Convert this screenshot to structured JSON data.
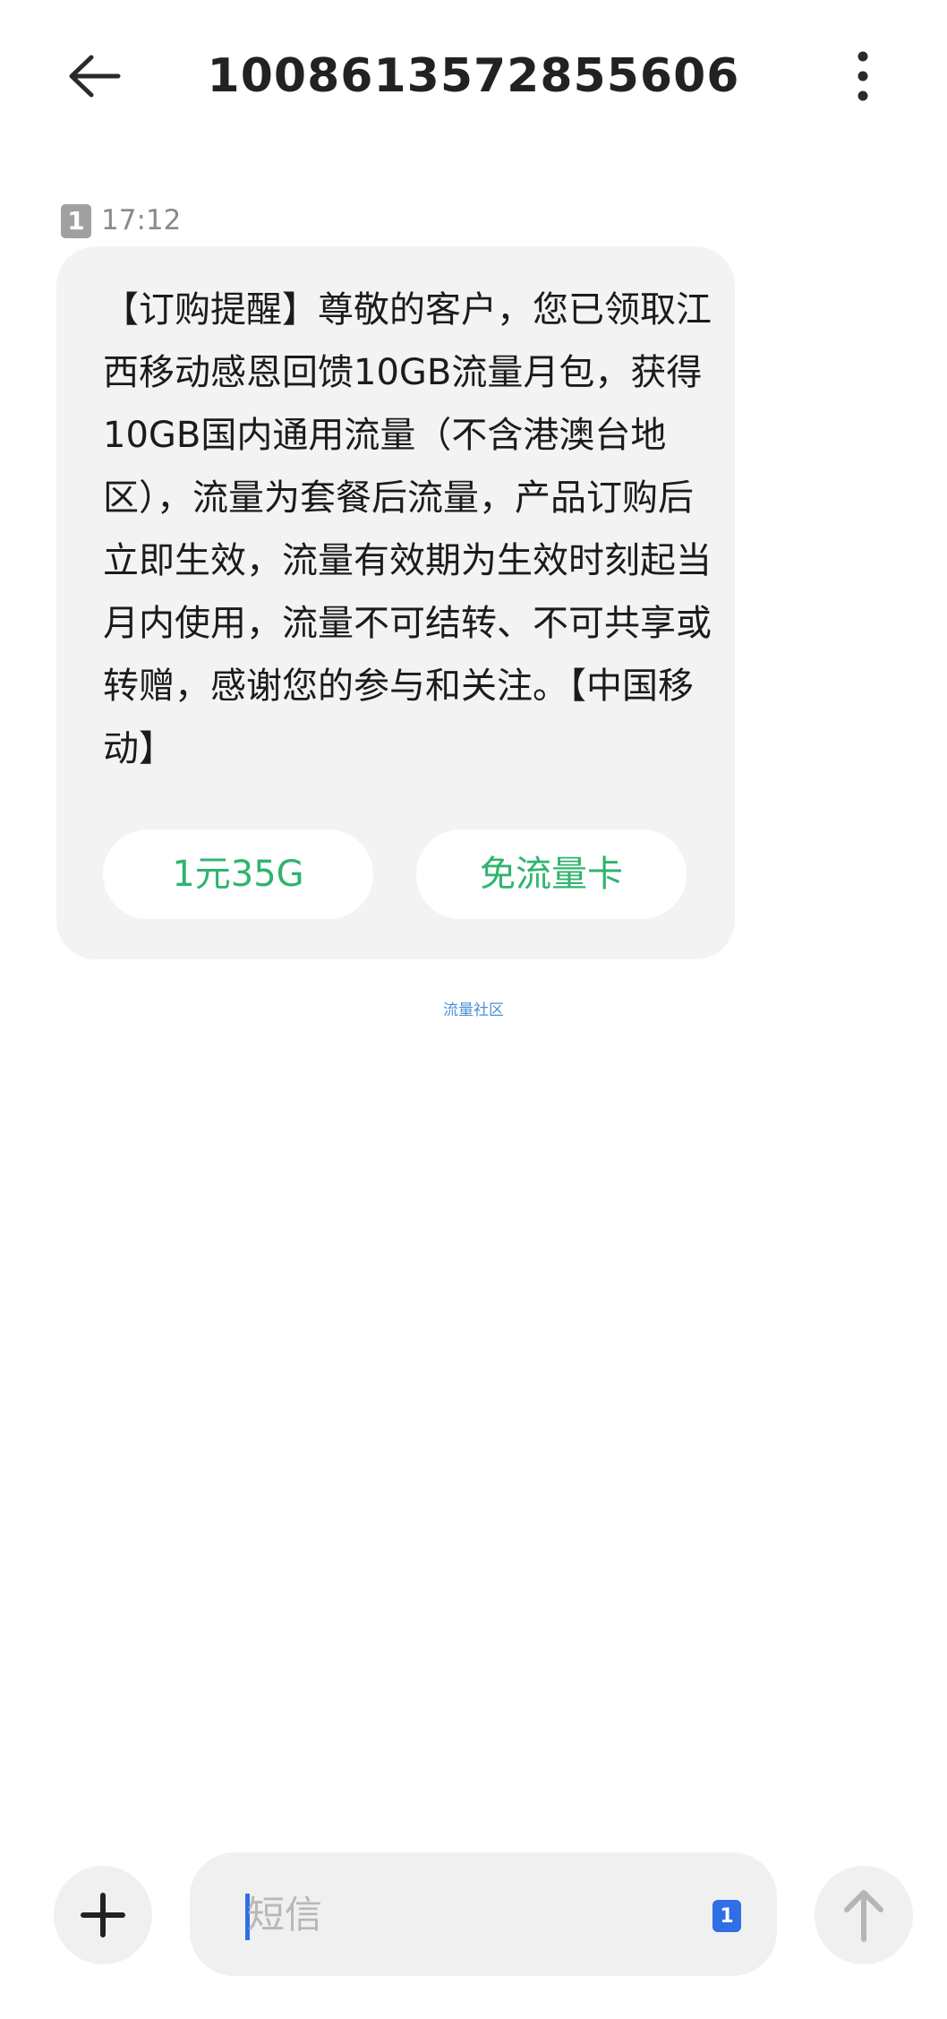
{
  "header": {
    "title": "1008613572855606",
    "back_icon": "arrow-left-icon",
    "more_icon": "more-vertical-icon"
  },
  "message": {
    "sim_slot": "1",
    "time": "17:12",
    "body": "【订购提醒】尊敬的客户，您已领取江西移动感恩回馈10GB流量月包，获得10GB国内通用流量（不含港澳台地区），流量为套餐后流量，产品订购后立即生效，流量有效期为生效时刻起当月内使用，流量不可结转、不可共享或转赠，感谢您的参与和关注。【中国移动】",
    "actions": [
      "1元35G",
      "免流量卡"
    ]
  },
  "community_link": "流量社区",
  "composer": {
    "placeholder": "短信",
    "sim_slot": "1",
    "add_icon": "plus-icon",
    "send_icon": "arrow-up-icon"
  },
  "colors": {
    "accent_green": "#2eb46e",
    "sim_blue": "#2f6fe6",
    "bubble_bg": "#f3f3f3"
  }
}
